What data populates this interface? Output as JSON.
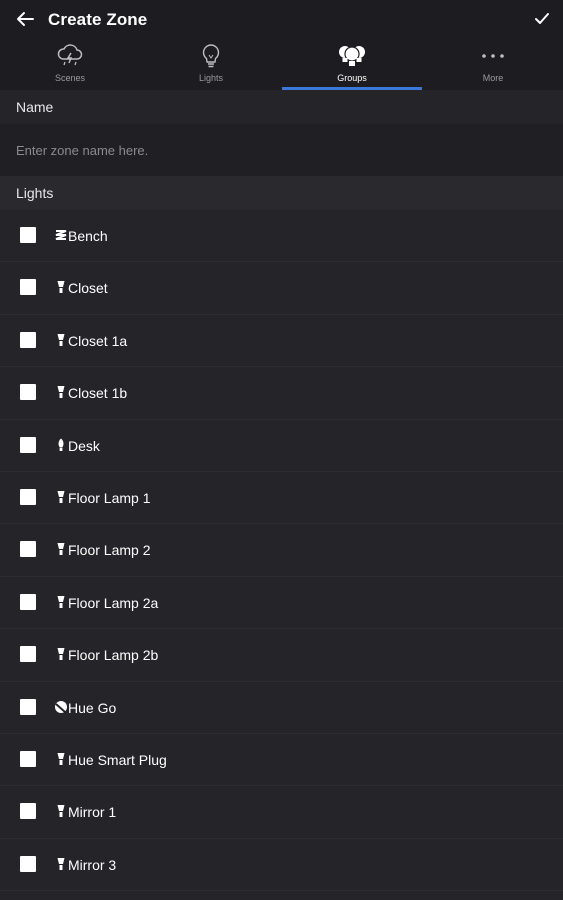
{
  "header": {
    "title": "Create Zone",
    "back_icon": "arrow-left-icon",
    "confirm_icon": "checkmark-icon"
  },
  "tabs": [
    {
      "label": "Scenes",
      "icon": "scenes-icon",
      "active": false
    },
    {
      "label": "Lights",
      "icon": "bulb-icon",
      "active": false
    },
    {
      "label": "Groups",
      "icon": "groups-icon",
      "active": true
    },
    {
      "label": "More",
      "icon": "more-icon",
      "active": false
    }
  ],
  "colors": {
    "accent": "#3c78d8",
    "background": "#242429",
    "header_bg": "#1d1d21"
  },
  "name_section": {
    "label": "Name",
    "input_value": "",
    "placeholder": "Enter zone name here."
  },
  "lights_section": {
    "label": "Lights",
    "items": [
      {
        "name": "Bench",
        "icon": "lightstrip-icon",
        "checked": false
      },
      {
        "name": "Closet",
        "icon": "bulb-small-icon",
        "checked": false
      },
      {
        "name": "Closet 1a",
        "icon": "bulb-small-icon",
        "checked": false
      },
      {
        "name": "Closet 1b",
        "icon": "bulb-small-icon",
        "checked": false
      },
      {
        "name": "Desk",
        "icon": "candle-bulb-icon",
        "checked": false
      },
      {
        "name": "Floor Lamp 1",
        "icon": "bulb-small-icon",
        "checked": false
      },
      {
        "name": "Floor Lamp 2",
        "icon": "bulb-small-icon",
        "checked": false
      },
      {
        "name": "Floor Lamp 2a",
        "icon": "bulb-small-icon",
        "checked": false
      },
      {
        "name": "Floor Lamp 2b",
        "icon": "bulb-small-icon",
        "checked": false
      },
      {
        "name": "Hue Go",
        "icon": "hue-go-icon",
        "checked": false
      },
      {
        "name": "Hue Smart Plug",
        "icon": "bulb-small-icon",
        "checked": false
      },
      {
        "name": "Mirror 1",
        "icon": "bulb-small-icon",
        "checked": false
      },
      {
        "name": "Mirror 3",
        "icon": "bulb-small-icon",
        "checked": false
      }
    ]
  }
}
